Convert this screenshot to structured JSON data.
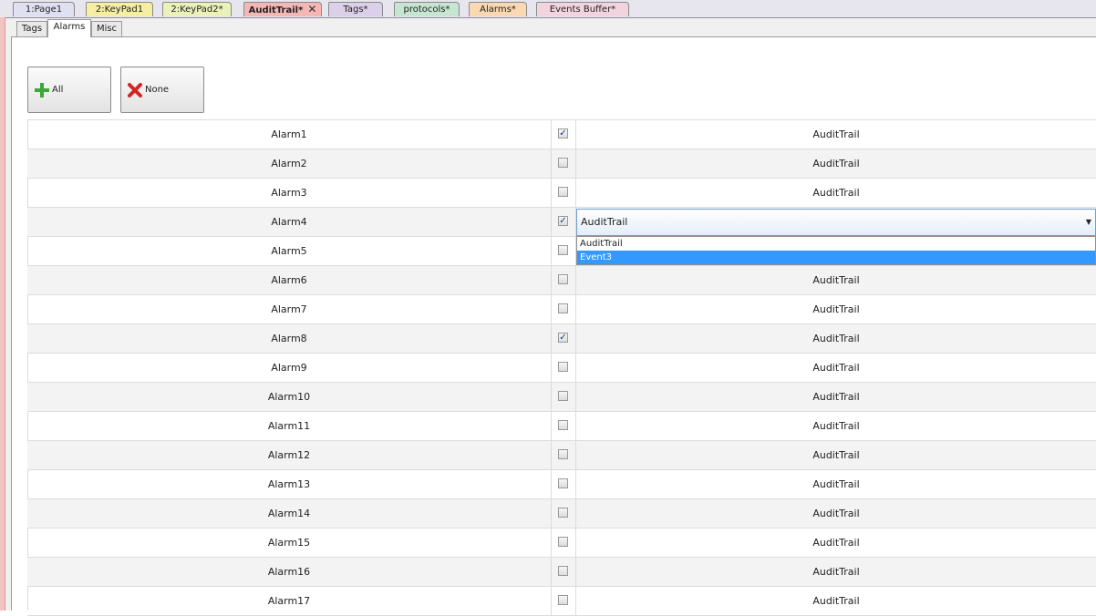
{
  "doc_tabs": [
    {
      "label": "1:Page1",
      "color": "#dfe1f2"
    },
    {
      "label": "2:KeyPad1",
      "color": "#f6eea0"
    },
    {
      "label": "2:KeyPad2*",
      "color": "#eaf2b9"
    },
    {
      "label": "AuditTrail*",
      "color": "#f4b7b5"
    },
    {
      "label": "Tags*",
      "color": "#dccfe9"
    },
    {
      "label": "protocols*",
      "color": "#c7e6d1"
    },
    {
      "label": "Alarms*",
      "color": "#f9d8b2"
    },
    {
      "label": "Events Buffer*",
      "color": "#f2d4de"
    }
  ],
  "doc_tab_close": "✕",
  "sub_tabs": [
    "Tags",
    "Alarms",
    "Misc"
  ],
  "buttons": {
    "all": "All",
    "none": "None"
  },
  "rows": [
    {
      "name": "Alarm1",
      "checked": true,
      "target": "AuditTrail"
    },
    {
      "name": "Alarm2",
      "checked": false,
      "target": "AuditTrail"
    },
    {
      "name": "Alarm3",
      "checked": false,
      "target": "AuditTrail"
    },
    {
      "name": "Alarm4",
      "checked": true,
      "target": ""
    },
    {
      "name": "Alarm5",
      "checked": false,
      "target": ""
    },
    {
      "name": "Alarm6",
      "checked": false,
      "target": "AuditTrail"
    },
    {
      "name": "Alarm7",
      "checked": false,
      "target": "AuditTrail"
    },
    {
      "name": "Alarm8",
      "checked": true,
      "target": "AuditTrail"
    },
    {
      "name": "Alarm9",
      "checked": false,
      "target": "AuditTrail"
    },
    {
      "name": "Alarm10",
      "checked": false,
      "target": "AuditTrail"
    },
    {
      "name": "Alarm11",
      "checked": false,
      "target": "AuditTrail"
    },
    {
      "name": "Alarm12",
      "checked": false,
      "target": "AuditTrail"
    },
    {
      "name": "Alarm13",
      "checked": false,
      "target": "AuditTrail"
    },
    {
      "name": "Alarm14",
      "checked": false,
      "target": "AuditTrail"
    },
    {
      "name": "Alarm15",
      "checked": false,
      "target": "AuditTrail"
    },
    {
      "name": "Alarm16",
      "checked": false,
      "target": "AuditTrail"
    },
    {
      "name": "Alarm17",
      "checked": false,
      "target": "AuditTrail"
    }
  ],
  "dropdown": {
    "value": "AuditTrail",
    "options": [
      "AuditTrail",
      "Event3"
    ],
    "highlighted": "Event3"
  },
  "icons": {
    "all": "green-plus-icon",
    "none": "red-x-icon",
    "dropdown": "chevron-down-icon"
  }
}
